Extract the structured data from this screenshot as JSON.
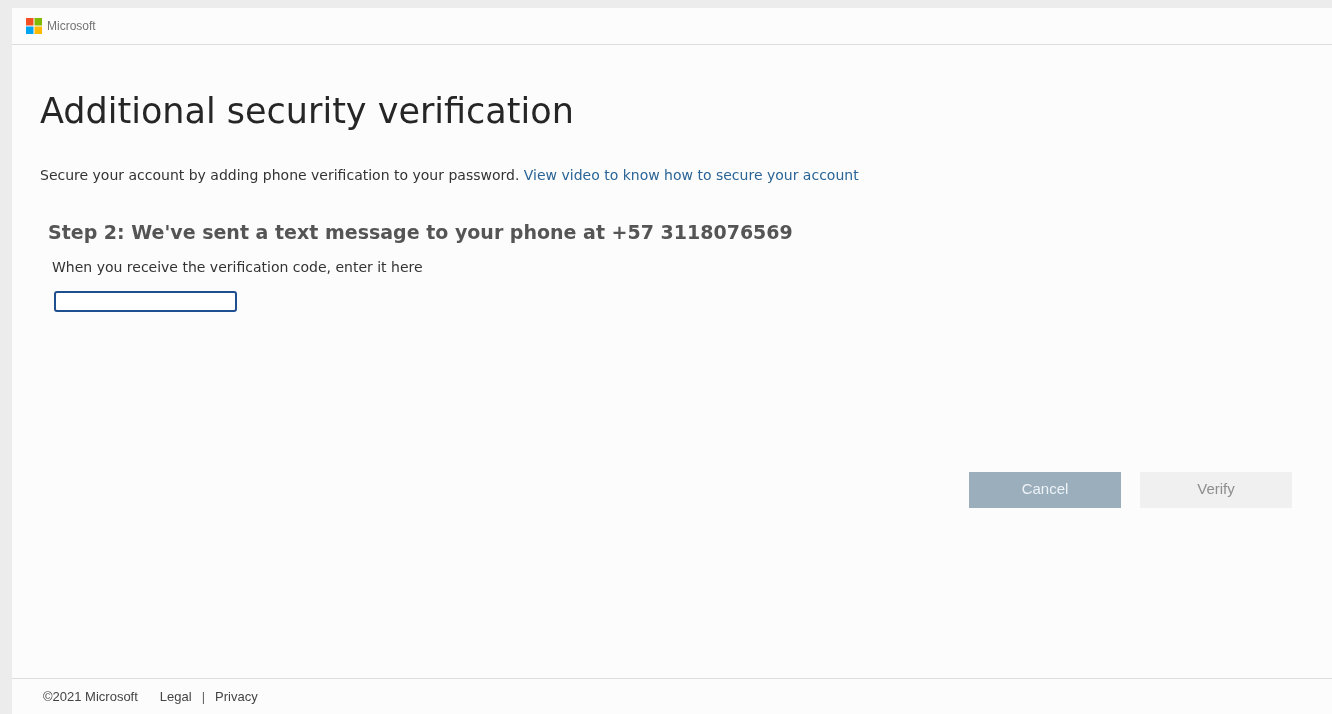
{
  "header": {
    "brand": "Microsoft"
  },
  "title": "Additional security verification",
  "intro": {
    "text": "Secure your account by adding phone verification to your password.",
    "link": "View video to know how to secure your account"
  },
  "step": {
    "heading": "Step 2: We've sent a text message to your phone at +57 3118076569",
    "label": "When you receive the verification code, enter it here",
    "code_field": {
      "focused": true
    }
  },
  "buttons": [
    {
      "label": "Cancel",
      "disabled": false
    },
    {
      "label": "Verify",
      "disabled": true
    }
  ],
  "footer": {
    "copyright": "©2021 Microsoft",
    "links": [
      "Legal",
      "Privacy"
    ],
    "separator": "|"
  }
}
